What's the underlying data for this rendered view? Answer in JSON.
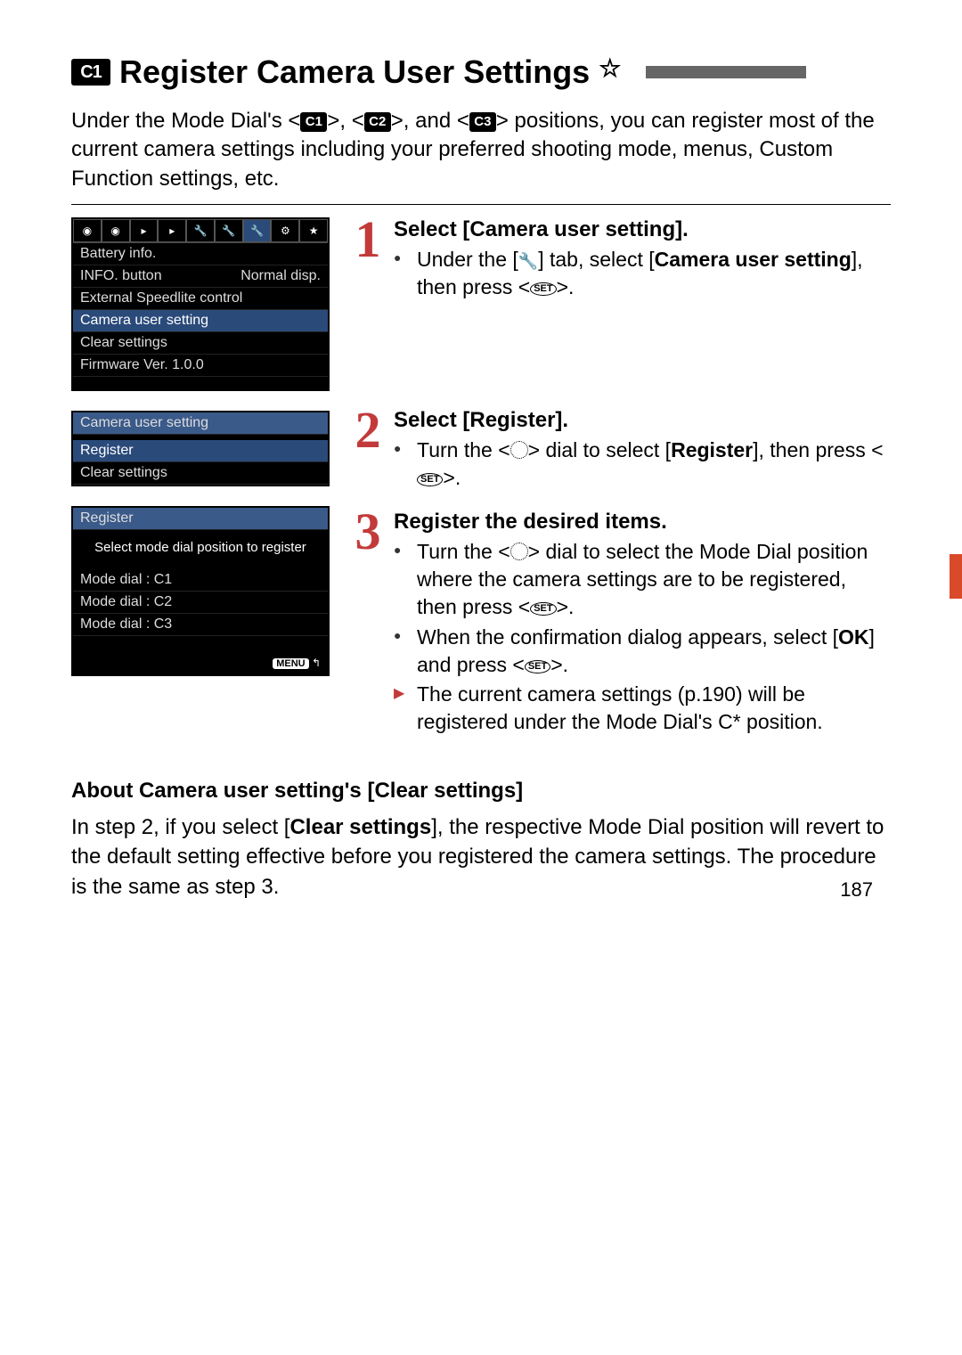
{
  "title": {
    "c1": "C1",
    "text": "Register Camera User Settings",
    "star": "☆"
  },
  "intro": {
    "t1": "Under the Mode Dial's <",
    "c1": "C1",
    "t2": ">, <",
    "c2": "C2",
    "t3": ">, and <",
    "c3": "C3",
    "t4": "> positions, you can register most of the current camera settings including your preferred shooting mode, menus, Custom Function settings, etc."
  },
  "lcd1": {
    "rows": [
      {
        "l": "Battery info.",
        "r": ""
      },
      {
        "l": "INFO. button",
        "r": "Normal disp."
      },
      {
        "l": "External Speedlite control",
        "r": ""
      },
      {
        "l": "Camera user setting",
        "r": "",
        "sel": true
      },
      {
        "l": "Clear settings",
        "r": ""
      },
      {
        "l": "Firmware Ver. 1.0.0",
        "r": ""
      }
    ]
  },
  "lcd2": {
    "title": "Camera user setting",
    "rows": [
      {
        "l": "Register",
        "sel": true
      },
      {
        "l": "Clear settings"
      }
    ]
  },
  "lcd3": {
    "title": "Register",
    "msg": "Select mode dial position to register",
    "rows": [
      {
        "l": "Mode dial : C1"
      },
      {
        "l": "Mode dial : C2"
      },
      {
        "l": "Mode dial : C3"
      }
    ],
    "menu": "MENU",
    "return": "↰"
  },
  "steps": {
    "s1": {
      "num": "1",
      "title": "Select [Camera user setting].",
      "b1a": "Under the [",
      "b1b": "] tab, select [",
      "b1c": "Camera user setting",
      "b1d": "], then press <",
      "b1e": ">.",
      "set": "SET"
    },
    "s2": {
      "num": "2",
      "title": "Select [Register].",
      "b1a": "Turn the <",
      "b1b": "> dial to select [",
      "b1c": "Register",
      "b1d": "], then press <",
      "b1e": ">.",
      "set": "SET"
    },
    "s3": {
      "num": "3",
      "title": "Register the desired items.",
      "b1a": "Turn the <",
      "b1b": "> dial to select the Mode Dial position where the camera settings are to be registered, then press <",
      "b1c": ">.",
      "b2a": "When the confirmation dialog appears, select [",
      "b2b": "OK",
      "b2c": "] and press <",
      "b2d": ">.",
      "b3": "The current camera settings (p.190) will be registered under the Mode Dial's C* position.",
      "set": "SET"
    }
  },
  "about": {
    "title": "About Camera user setting's [Clear settings]",
    "t1": "In step 2, if you select [",
    "t2": "Clear settings",
    "t3": "], the respective Mode Dial position will revert to the default setting effective before you registered the camera settings. The procedure is the same as step 3."
  },
  "page_num": "187"
}
